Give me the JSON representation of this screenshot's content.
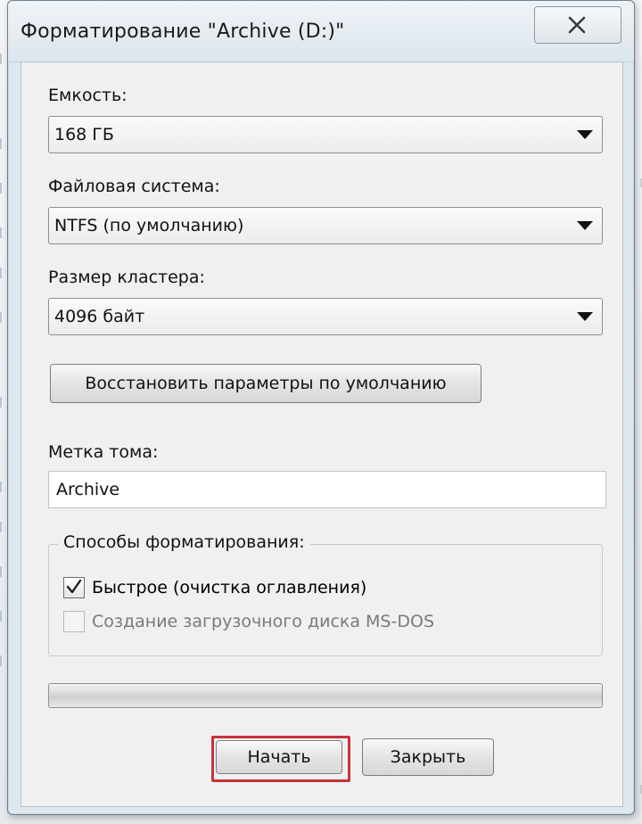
{
  "window": {
    "title": "Форматирование \"Archive (D:)\""
  },
  "titlebar": {
    "close_icon": "close-x-icon"
  },
  "capacity": {
    "label": "Емкость:",
    "value": "168 ГБ"
  },
  "filesystem": {
    "label": "Файловая система:",
    "value": "NTFS (по умолчанию)"
  },
  "cluster": {
    "label": "Размер кластера:",
    "value": "4096 байт"
  },
  "restore_button": {
    "label": "Восстановить параметры по умолчанию"
  },
  "volume_label": {
    "label": "Метка тома:",
    "value": "Archive"
  },
  "format_options": {
    "title": "Способы форматирования:",
    "quick": {
      "label": "Быстрое (очистка оглавления)",
      "checked": true,
      "enabled": true
    },
    "msdos": {
      "label": "Создание загрузочного диска MS-DOS",
      "checked": false,
      "enabled": false
    }
  },
  "progress": {
    "value_percent": 0
  },
  "actions": {
    "start_label": "Начать",
    "close_label": "Закрыть"
  },
  "colors": {
    "highlight": "#c8323a",
    "progress_fill": "#3fbf38"
  }
}
